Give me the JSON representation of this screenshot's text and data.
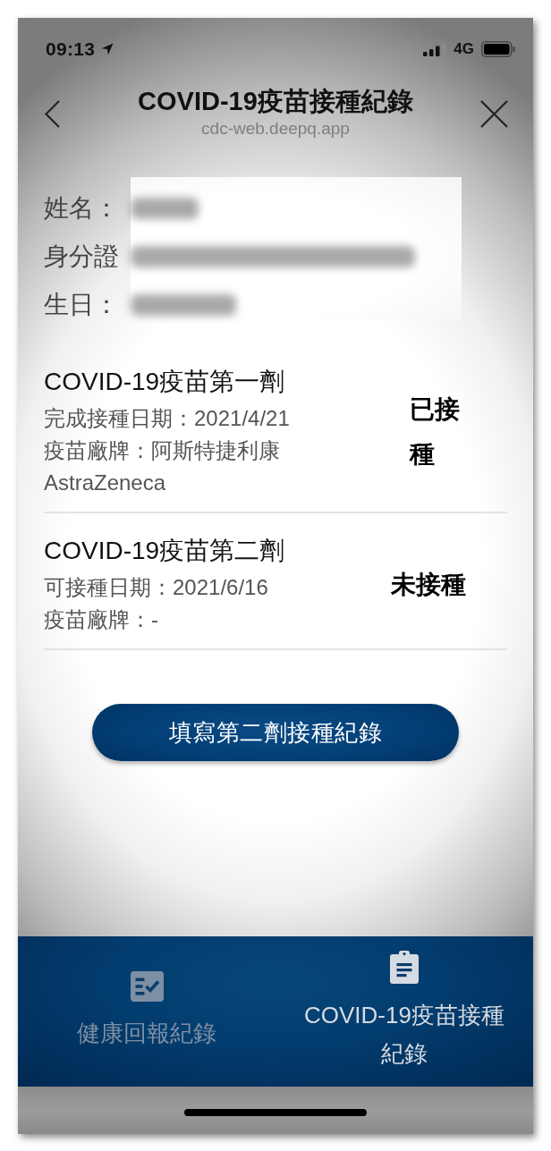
{
  "status_bar": {
    "time": "09:13",
    "network": "4G"
  },
  "header": {
    "title": "COVID-19疫苗接種紀錄",
    "url": "cdc-web.deepq.app"
  },
  "profile": {
    "fields": [
      "姓名：",
      "身分證",
      "生日："
    ]
  },
  "doses": [
    {
      "title": "COVID-19疫苗第一劑",
      "details": [
        "完成接種日期：2021/4/21",
        "疫苗廠牌：阿斯特捷利康 AstraZeneca"
      ],
      "status": "已接種"
    },
    {
      "title": "COVID-19疫苗第二劑",
      "details": [
        "可接種日期：2021/6/16",
        "疫苗廠牌：-"
      ],
      "status": "未接種"
    }
  ],
  "action_button": {
    "label": "填寫第二劑接種紀錄"
  },
  "tab_bar": {
    "tabs": [
      {
        "label": "健康回報紀錄",
        "selected": false
      },
      {
        "label": "COVID-19疫苗接種紀錄",
        "selected": true
      }
    ]
  }
}
